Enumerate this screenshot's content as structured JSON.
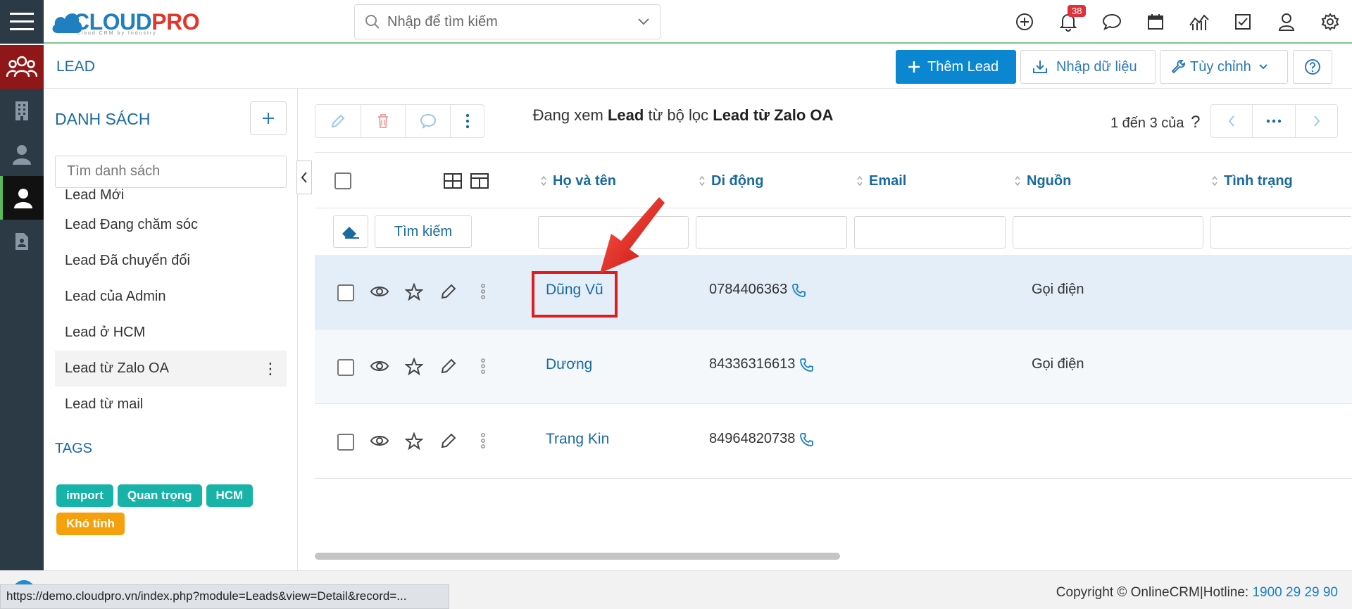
{
  "app": {
    "logo_text_a": "CLOUD",
    "logo_text_b": "PRO",
    "logo_tagline": "cloud CRM by Industry",
    "search_placeholder": "Nhập để tìm kiếm",
    "notification_count": "38"
  },
  "header": {
    "module_title": "LEAD",
    "add_button": "Thêm Lead",
    "import_button": "Nhập dữ liệu",
    "customize_button": "Tùy chỉnh"
  },
  "sidebar": {
    "title": "DANH SÁCH",
    "search_placeholder": "Tìm danh sách",
    "items": [
      {
        "label": "Lead Mới"
      },
      {
        "label": "Lead Đang chăm sóc"
      },
      {
        "label": "Lead Đã chuyển đổi"
      },
      {
        "label": "Lead của Admin"
      },
      {
        "label": "Lead ở HCM"
      },
      {
        "label": "Lead từ Zalo OA"
      },
      {
        "label": "Lead từ mail"
      }
    ],
    "tags_title": "TAGS",
    "tags": [
      {
        "label": "import",
        "color": "#17b3a8"
      },
      {
        "label": "Quan trọng",
        "color": "#17b3a8"
      },
      {
        "label": "HCM",
        "color": "#17b3a8"
      },
      {
        "label": "Khó tính",
        "color": "#f5a00d"
      }
    ]
  },
  "list": {
    "viewing_prefix": "Đang xem",
    "viewing_module": "Lead",
    "viewing_middle": "từ bộ lọc",
    "viewing_filter": "Lead từ Zalo OA",
    "pager_text": "1 đến 3 của",
    "pager_unknown": "?",
    "search_button": "Tìm kiếm",
    "columns": [
      {
        "label": "Họ và tên"
      },
      {
        "label": "Di động"
      },
      {
        "label": "Email"
      },
      {
        "label": "Nguồn"
      },
      {
        "label": "Tình trạng"
      }
    ],
    "rows": [
      {
        "name": "Dũng Vũ",
        "phone": "0784406363",
        "email": "",
        "source": "Gọi điện",
        "status": ""
      },
      {
        "name": "Dương",
        "phone": "84336316613",
        "email": "",
        "source": "Gọi điện",
        "status": ""
      },
      {
        "name": "Trang Kin",
        "phone": "84964820738",
        "email": "",
        "source": "",
        "status": ""
      }
    ]
  },
  "footer": {
    "copyright": "Copyright © OnlineCRM|Hotline: ",
    "hotline": "1900 29 29 90",
    "status_url": "https://demo.cloudpro.vn/index.php?module=Leads&view=Detail&record=..."
  },
  "colors": {
    "accent": "#1a6aa0",
    "primary_button": "#0b86d1",
    "sidebar_dark": "#2c3a46",
    "highlight_row": "#e4eef8",
    "annotation_red": "#e21c1c"
  }
}
